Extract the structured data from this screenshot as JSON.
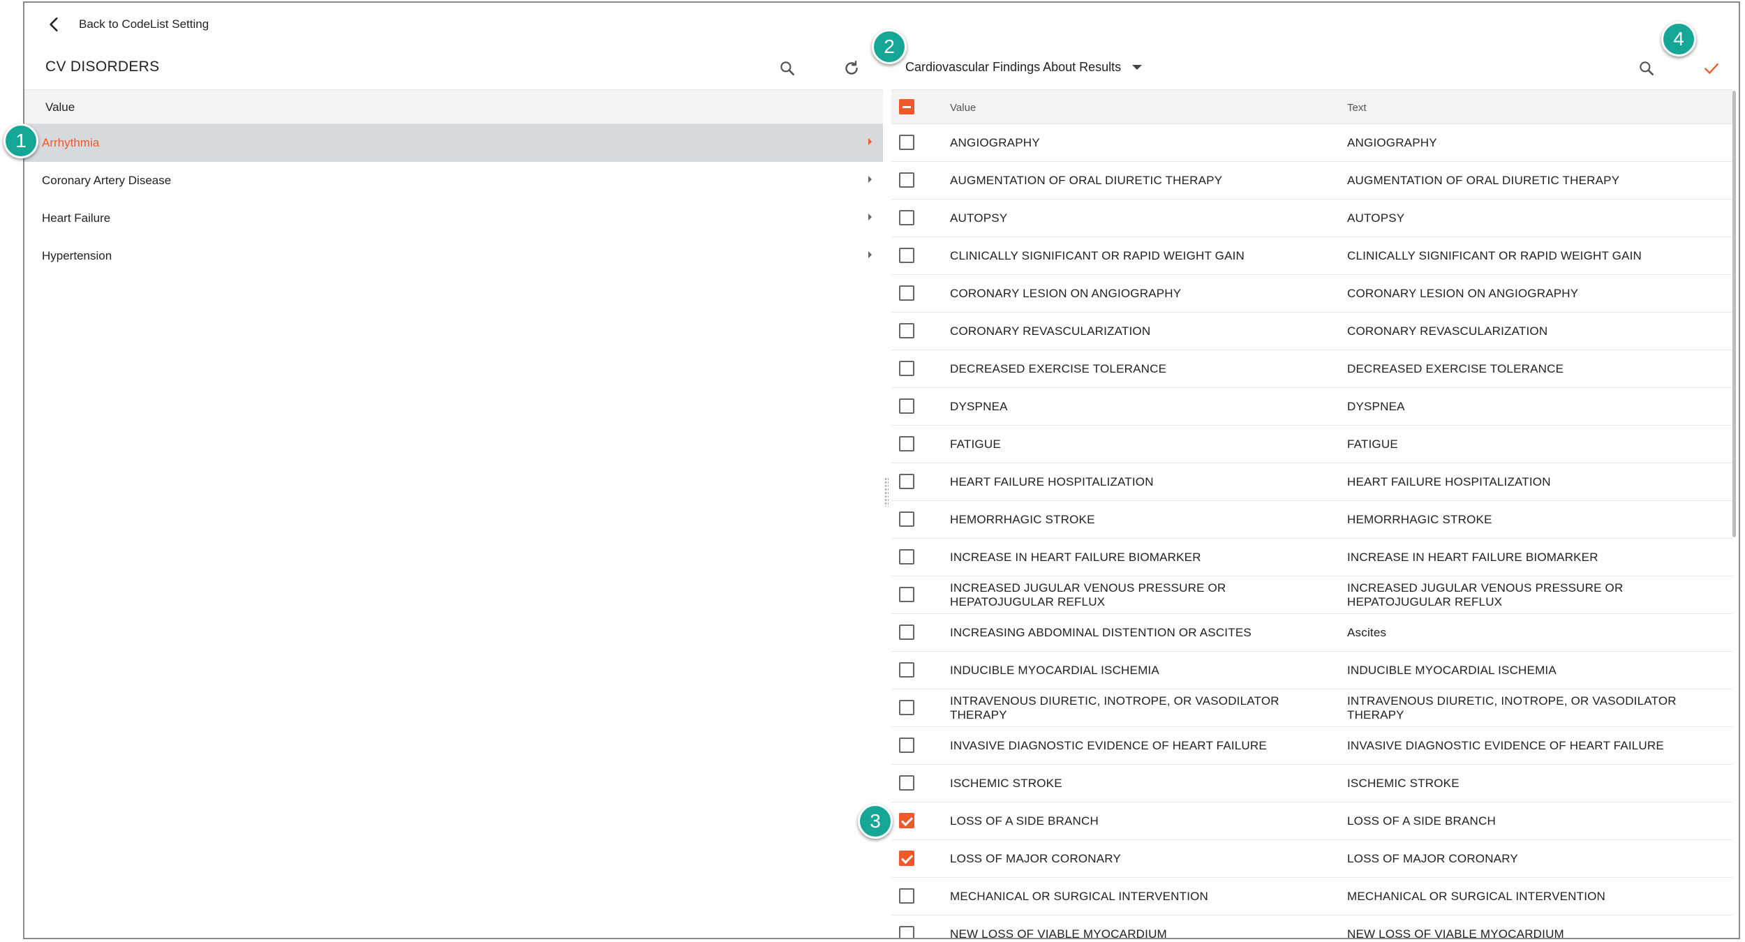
{
  "back": {
    "label": "Back to CodeList Setting",
    "icon": "chevron-left-icon"
  },
  "left": {
    "title": "CV DISORDERS",
    "column_header": "Value",
    "items": [
      {
        "label": "Arrhythmia",
        "selected": true
      },
      {
        "label": "Coronary Artery Disease",
        "selected": false
      },
      {
        "label": "Heart Failure",
        "selected": false
      },
      {
        "label": "Hypertension",
        "selected": false
      }
    ]
  },
  "right": {
    "dropdown_value": "Cardiovascular Findings About Results",
    "header": {
      "value": "Value",
      "text": "Text",
      "select_all_state": "indeterminate"
    },
    "rows": [
      {
        "value": "ANGIOGRAPHY",
        "text": "ANGIOGRAPHY",
        "checked": false
      },
      {
        "value": "AUGMENTATION OF ORAL DIURETIC THERAPY",
        "text": "AUGMENTATION OF ORAL DIURETIC THERAPY",
        "checked": false
      },
      {
        "value": "AUTOPSY",
        "text": "AUTOPSY",
        "checked": false
      },
      {
        "value": "CLINICALLY SIGNIFICANT OR RAPID WEIGHT GAIN",
        "text": "CLINICALLY SIGNIFICANT OR RAPID WEIGHT GAIN",
        "checked": false
      },
      {
        "value": "CORONARY LESION ON ANGIOGRAPHY",
        "text": "CORONARY LESION ON ANGIOGRAPHY",
        "checked": false
      },
      {
        "value": "CORONARY REVASCULARIZATION",
        "text": "CORONARY REVASCULARIZATION",
        "checked": false
      },
      {
        "value": "DECREASED EXERCISE TOLERANCE",
        "text": "DECREASED EXERCISE TOLERANCE",
        "checked": false
      },
      {
        "value": "DYSPNEA",
        "text": "DYSPNEA",
        "checked": false
      },
      {
        "value": "FATIGUE",
        "text": "FATIGUE",
        "checked": false
      },
      {
        "value": "HEART FAILURE HOSPITALIZATION",
        "text": "HEART FAILURE HOSPITALIZATION",
        "checked": false
      },
      {
        "value": "HEMORRHAGIC STROKE",
        "text": "HEMORRHAGIC STROKE",
        "checked": false
      },
      {
        "value": "INCREASE IN HEART FAILURE BIOMARKER",
        "text": "INCREASE IN HEART FAILURE BIOMARKER",
        "checked": false
      },
      {
        "value": "INCREASED JUGULAR VENOUS PRESSURE OR HEPATOJUGULAR REFLUX",
        "text": "INCREASED JUGULAR VENOUS PRESSURE OR HEPATOJUGULAR REFLUX",
        "checked": false
      },
      {
        "value": "INCREASING ABDOMINAL DISTENTION OR ASCITES",
        "text": "Ascites",
        "checked": false
      },
      {
        "value": "INDUCIBLE MYOCARDIAL ISCHEMIA",
        "text": "INDUCIBLE MYOCARDIAL ISCHEMIA",
        "checked": false
      },
      {
        "value": "INTRAVENOUS DIURETIC, INOTROPE, OR VASODILATOR THERAPY",
        "text": "INTRAVENOUS DIURETIC, INOTROPE, OR VASODILATOR THERAPY",
        "checked": false
      },
      {
        "value": "INVASIVE DIAGNOSTIC EVIDENCE OF HEART FAILURE",
        "text": "INVASIVE DIAGNOSTIC EVIDENCE OF HEART FAILURE",
        "checked": false
      },
      {
        "value": "ISCHEMIC STROKE",
        "text": "ISCHEMIC STROKE",
        "checked": false
      },
      {
        "value": "LOSS OF A SIDE BRANCH",
        "text": "LOSS OF A SIDE BRANCH",
        "checked": true
      },
      {
        "value": "LOSS OF MAJOR CORONARY",
        "text": "LOSS OF MAJOR CORONARY",
        "checked": true
      },
      {
        "value": "MECHANICAL OR SURGICAL INTERVENTION",
        "text": "MECHANICAL OR SURGICAL INTERVENTION",
        "checked": false
      },
      {
        "value": "NEW LOSS OF VIABLE MYOCARDIUM",
        "text": "NEW LOSS OF VIABLE MYOCARDIUM",
        "checked": false
      }
    ]
  },
  "callouts": [
    "1",
    "2",
    "3",
    "4"
  ],
  "colors": {
    "accent": "#f05a28",
    "callout": "#16a695",
    "selected_row": "#d6dadd",
    "header_bg": "#f3f3f3"
  }
}
